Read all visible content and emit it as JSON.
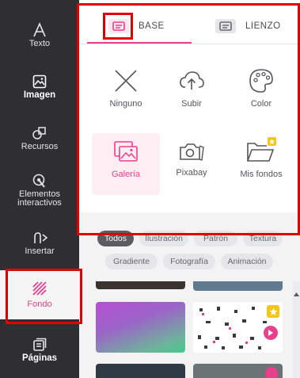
{
  "sidebar": {
    "items": [
      {
        "label": "Texto",
        "icon": "text-icon"
      },
      {
        "label": "Imagen",
        "icon": "image-icon"
      },
      {
        "label": "Recursos",
        "icon": "resources-icon"
      },
      {
        "label": "Elementos interactivos",
        "icon": "interactive-icon"
      },
      {
        "label": "Insertar",
        "icon": "insert-icon"
      },
      {
        "label": "Fondo",
        "icon": "background-icon"
      },
      {
        "label": "Páginas",
        "icon": "pages-icon"
      }
    ]
  },
  "tabs": [
    {
      "label": "BASE",
      "icon": "base-icon"
    },
    {
      "label": "LIENZO",
      "icon": "canvas-icon"
    }
  ],
  "options": [
    {
      "label": "Ninguno",
      "icon": "close-icon"
    },
    {
      "label": "Subir",
      "icon": "upload-cloud-icon"
    },
    {
      "label": "Color",
      "icon": "palette-icon"
    },
    {
      "label": "Galería",
      "icon": "gallery-icon"
    },
    {
      "label": "Pixabay",
      "icon": "camera-icon"
    },
    {
      "label": "Mis fondos",
      "icon": "folder-star-icon"
    }
  ],
  "filters": [
    "Todos",
    "Ilustración",
    "Patrón",
    "Textura",
    "Gradiente",
    "Fotografía",
    "Animación"
  ],
  "colors": {
    "accent": "#e8408a",
    "sidebar": "#2e2e33",
    "highlight": "#e00000",
    "star": "#f5c518"
  }
}
